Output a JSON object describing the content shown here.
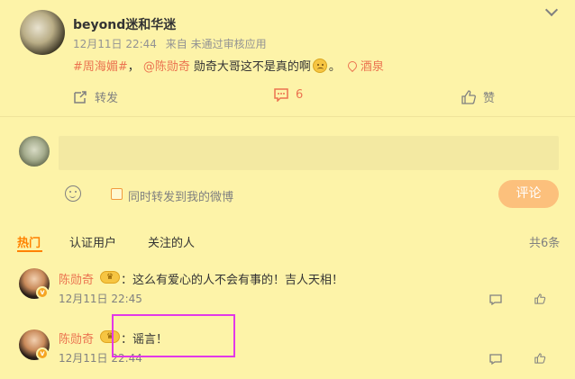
{
  "post": {
    "username": "beyond迷和华迷",
    "time": "12月11日 22:44",
    "source": "来自 未通过审核应用",
    "hashtag": "#周海媚#",
    "separator": "，",
    "mention": "@陈勋奇",
    "text": "勋奇大哥这不是真的啊",
    "punct": "。",
    "location": "酒泉",
    "actions": {
      "repost_label": "转发",
      "comment_count": "6",
      "like_label": "赞"
    }
  },
  "compose": {
    "placeholder": "",
    "also_repost_label": "同时转发到我的微博",
    "submit_label": "评论"
  },
  "tabs": {
    "hot": "热门",
    "verified": "认证用户",
    "following": "关注的人",
    "count": "共6条"
  },
  "comments": [
    {
      "name": "陈勋奇",
      "text": "：这么有爱心的人不会有事的！吉人天相！",
      "time": "12月11日 22:45"
    },
    {
      "name": "陈勋奇",
      "text": "：谣言！",
      "time": "12月11日 22:44"
    }
  ],
  "colors": {
    "background": "#fdf3a8",
    "accent": "#eb7350",
    "tab_active": "#ff8200",
    "submit": "#fcc07c",
    "highlight": "#e238e8"
  }
}
